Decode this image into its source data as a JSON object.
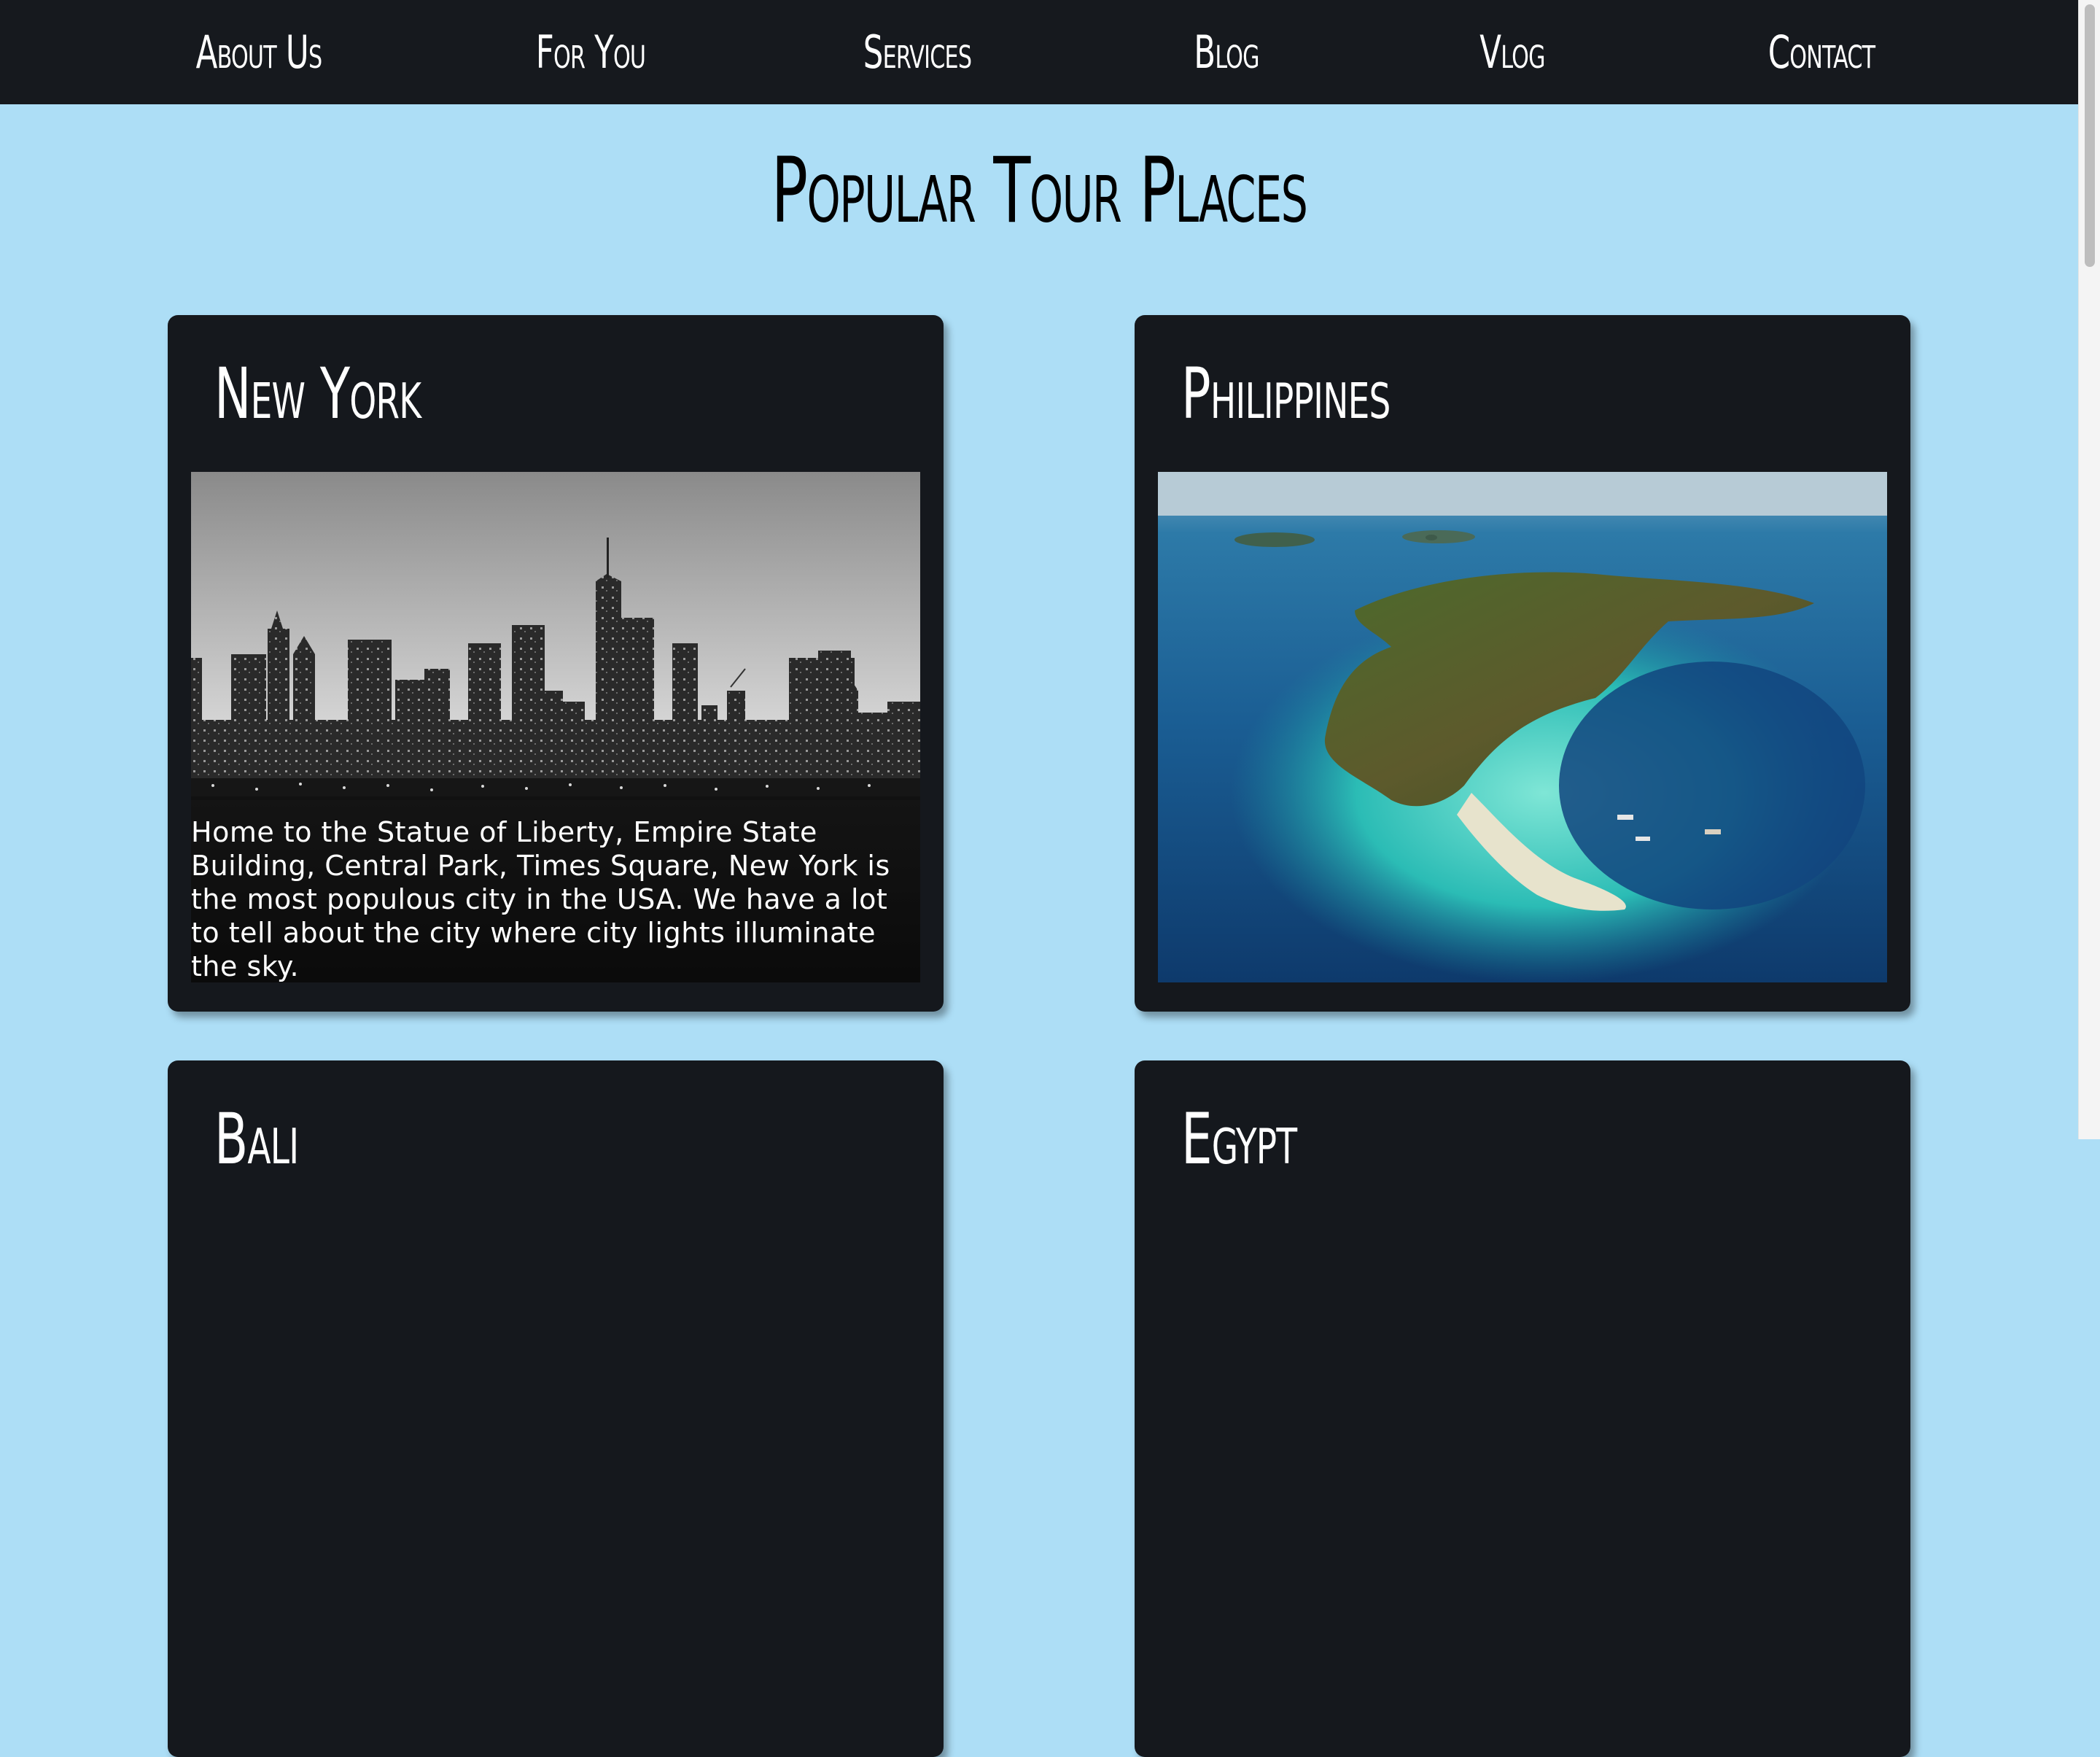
{
  "nav": {
    "items": [
      {
        "label": "About Us"
      },
      {
        "label": "For You"
      },
      {
        "label": "Services"
      },
      {
        "label": "Blog"
      },
      {
        "label": "Vlog"
      },
      {
        "label": "Contact"
      }
    ]
  },
  "main": {
    "title": "Popular Tour Places",
    "cards": [
      {
        "title": "New York",
        "image": "new-york-skyline-photo",
        "caption": "Home to the Statue of Liberty, Empire State Building, Central Park, Times Square, New York is the most populous city in the USA. We have a lot to tell about the city where city lights illuminate the sky."
      },
      {
        "title": "Philippines",
        "image": "philippines-island-aerial-photo"
      },
      {
        "title": "Bali"
      },
      {
        "title": "Egypt"
      }
    ]
  },
  "colors": {
    "background": "#ADDEF6",
    "nav_background": "#16191E",
    "card_background": "#15181D",
    "text_light": "#FFFFFF",
    "text_dark": "#000000"
  }
}
